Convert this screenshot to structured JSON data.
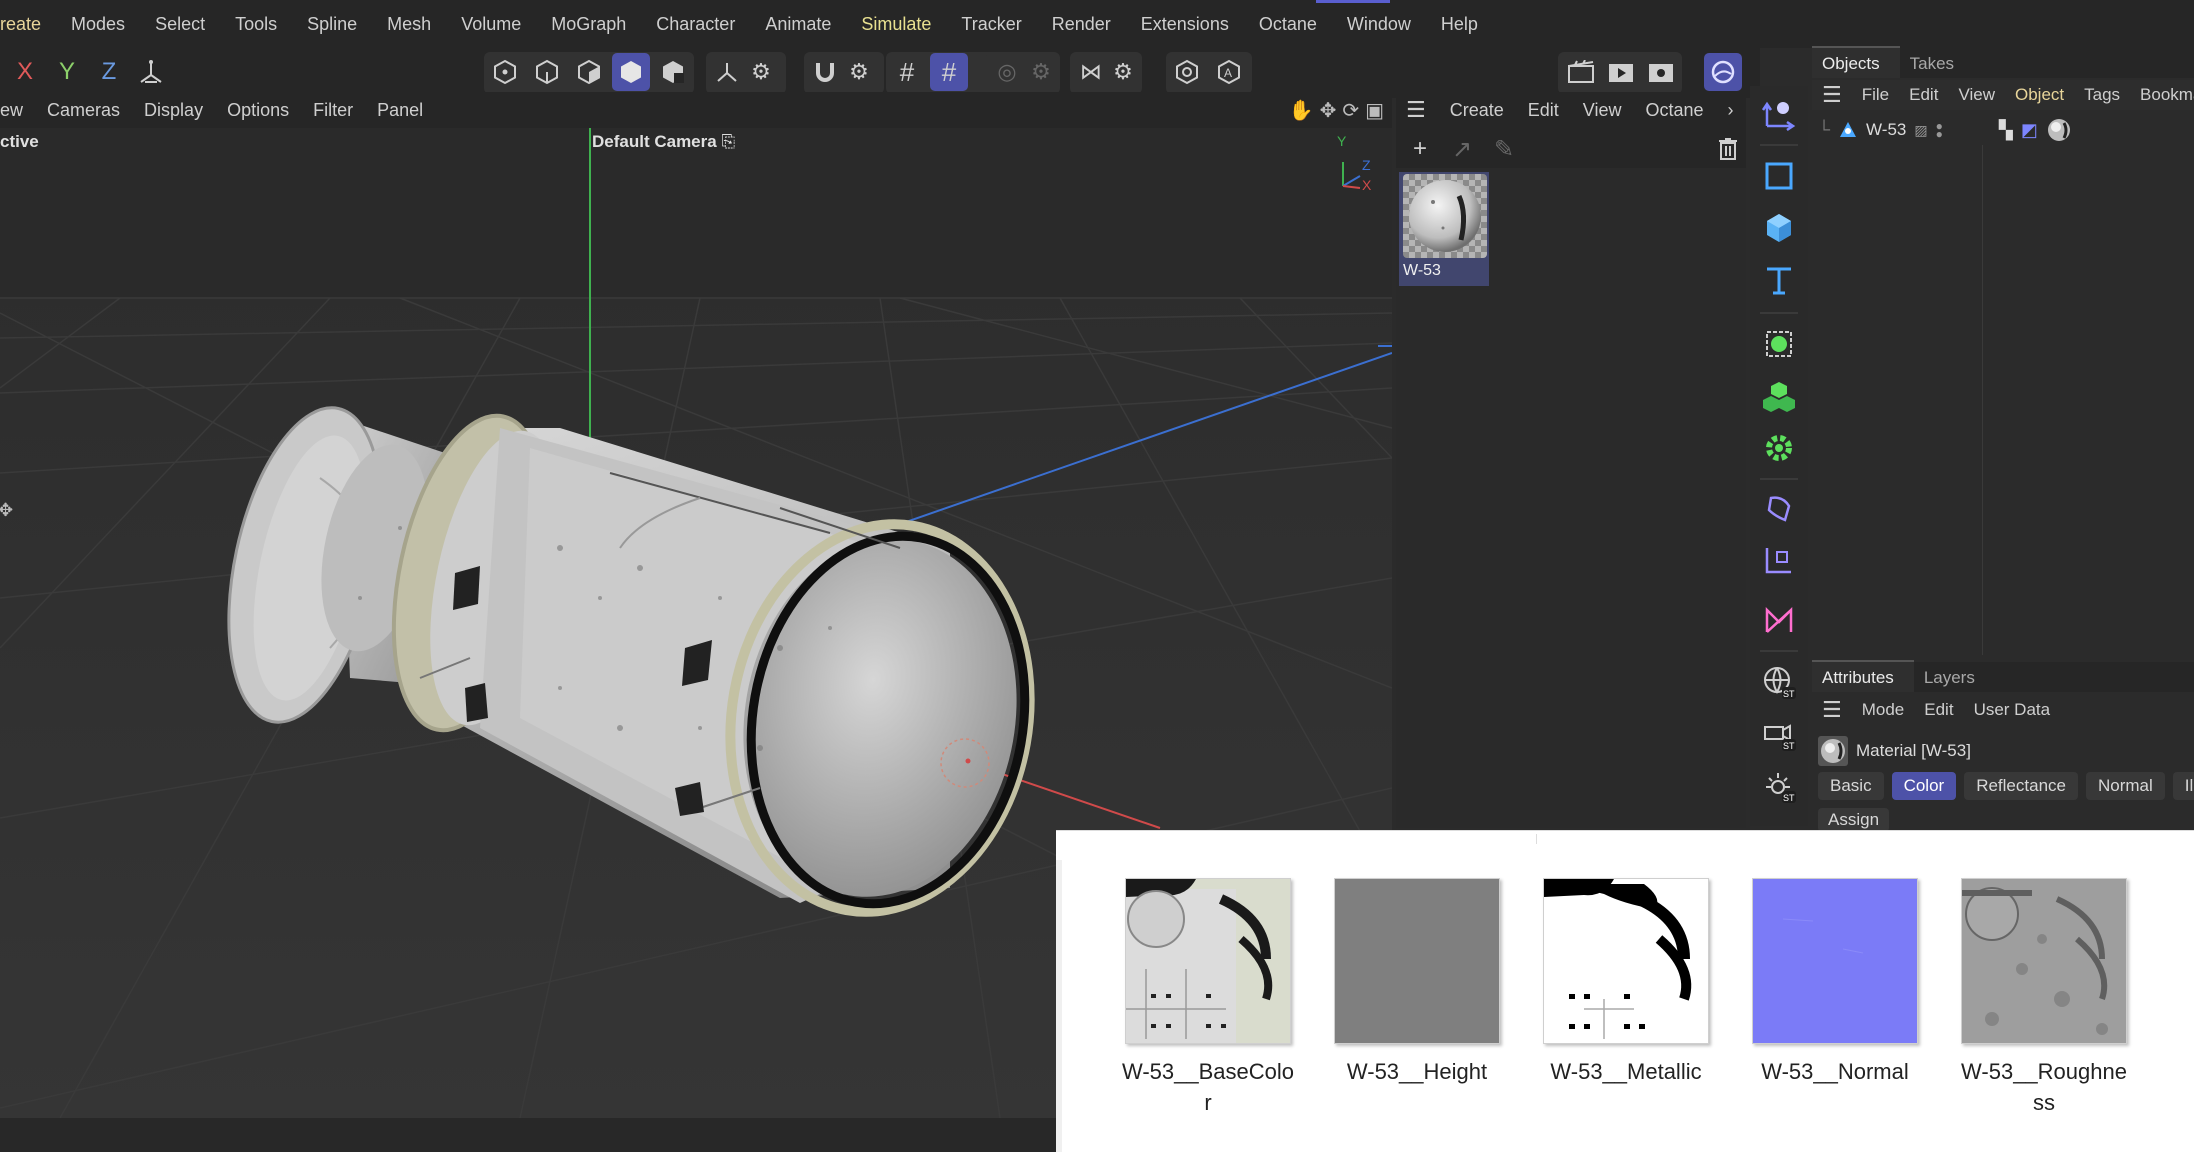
{
  "menubar": {
    "items": [
      "reate",
      "Modes",
      "Select",
      "Tools",
      "Spline",
      "Mesh",
      "Volume",
      "MoGraph",
      "Character",
      "Animate",
      "Simulate",
      "Tracker",
      "Render",
      "Extensions",
      "Octane",
      "Window",
      "Help"
    ],
    "highlighted": "Simulate"
  },
  "toolbar": {
    "axis_x": "X",
    "axis_y": "Y",
    "axis_z": "Z"
  },
  "viewport_menu": {
    "items": [
      "ew",
      "Cameras",
      "Display",
      "Options",
      "Filter",
      "Panel"
    ]
  },
  "viewport": {
    "left_label": "ctive",
    "camera_label": "Default Camera",
    "gizmo_y": "Y",
    "gizmo_z": "Z",
    "gizmo_x": "X"
  },
  "material_manager": {
    "menu": [
      "Create",
      "Edit",
      "View",
      "Octane"
    ],
    "more": "›",
    "material_name": "W-53"
  },
  "objects_panel": {
    "tabs": [
      "Objects",
      "Takes"
    ],
    "active_tab": "Objects",
    "menu": [
      "File",
      "Edit",
      "View",
      "Object",
      "Tags",
      "Bookmar"
    ],
    "highlighted_menu": "Object",
    "object_name": "W-53"
  },
  "attributes_panel": {
    "tabs": [
      "Attributes",
      "Layers"
    ],
    "active_tab": "Attributes",
    "menu": [
      "Mode",
      "Edit",
      "User Data"
    ],
    "title": "Material [W-53]",
    "channel_tabs": [
      "Basic",
      "Color",
      "Reflectance",
      "Normal",
      "Il"
    ],
    "active_channel": "Color",
    "assign_label": "Assign"
  },
  "file_explorer": {
    "files": [
      {
        "name": "W-53__BaseColor",
        "line1": "W-53__BaseColo",
        "line2": "r",
        "kind": "basecolor"
      },
      {
        "name": "W-53__Height",
        "line1": "W-53__Height",
        "line2": "",
        "kind": "height"
      },
      {
        "name": "W-53__Metallic",
        "line1": "W-53__Metallic",
        "line2": "",
        "kind": "metallic"
      },
      {
        "name": "W-53__Normal",
        "line1": "W-53__Normal",
        "line2": "",
        "kind": "normal"
      },
      {
        "name": "W-53__Roughness",
        "line1": "W-53__Roughne",
        "line2": "ss",
        "kind": "roughness"
      }
    ]
  },
  "colors": {
    "accent": "#4d52a8",
    "menu_highlight": "#e8e090",
    "normal_map": "#7b7bf7",
    "height_map": "#7f7f7f"
  }
}
